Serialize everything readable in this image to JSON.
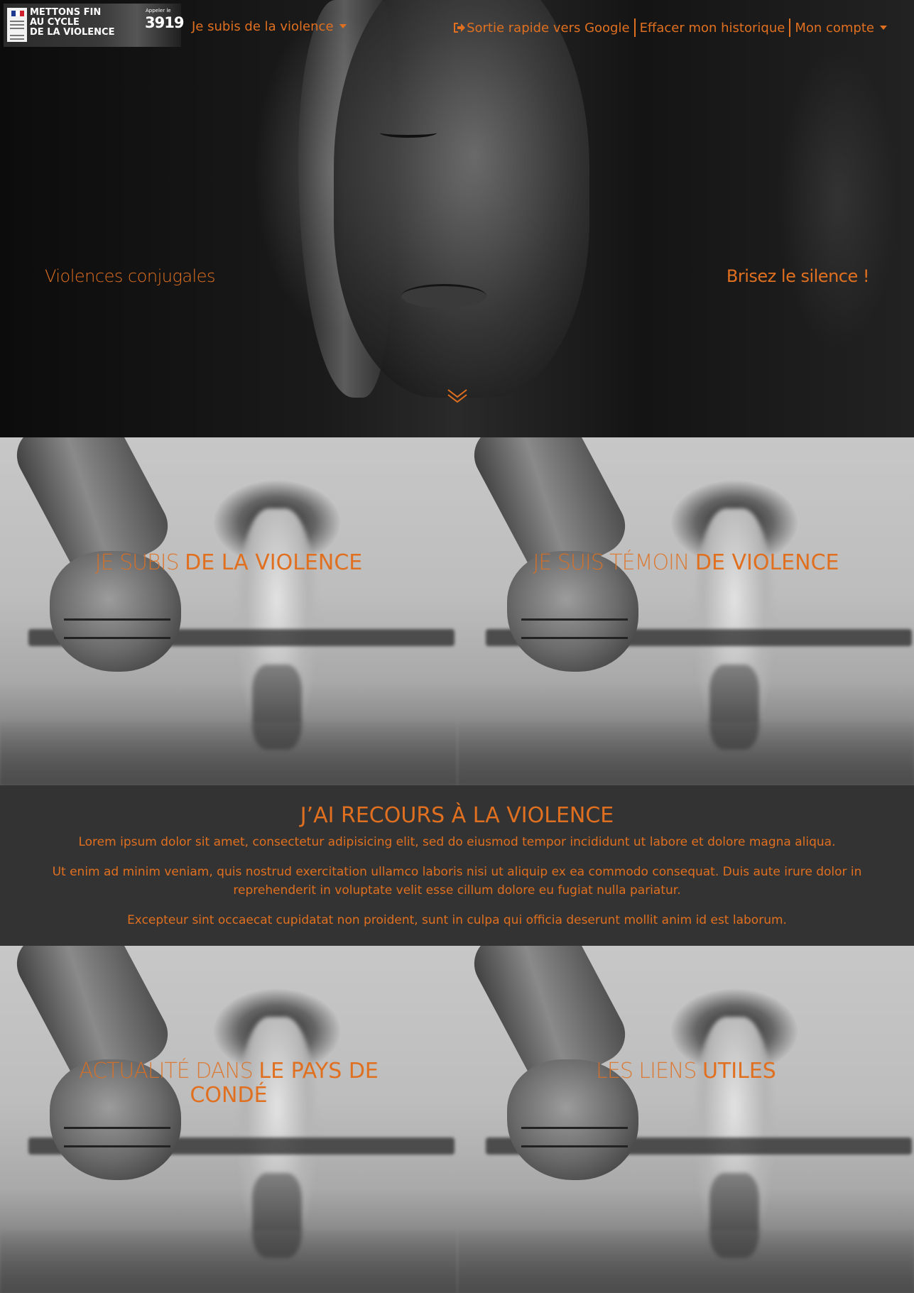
{
  "colors": {
    "accent": "#e07020",
    "dark_band": "#333333"
  },
  "logo": {
    "title": "METTONS FIN\nAU CYCLE\nDE LA VIOLENCE",
    "call_label": "Appeler le",
    "phone": "3919"
  },
  "nav": {
    "dropdown_label": "Je subis de la violence",
    "quick_exit": "Sortie rapide vers Google",
    "clear_history": "Effacer mon historique",
    "account": "Mon compte"
  },
  "hero": {
    "left_text": "Violences conjugales",
    "right_text": "Brisez le silence !",
    "scroll_icon": "chevron-down-icon"
  },
  "tiles": [
    {
      "light": "Je subis ",
      "bold": "de la violence"
    },
    {
      "light": "Je suis témoin ",
      "bold": "de violence"
    },
    {
      "light": "Actualité dans ",
      "bold": "le Pays de Condé"
    },
    {
      "light": "Les liens ",
      "bold": "utiles"
    }
  ],
  "band": {
    "title": "J’ai recours à la violence",
    "paragraphs": [
      "Lorem ipsum dolor sit amet, consectetur adipisicing elit, sed do eiusmod tempor incididunt ut labore et dolore magna aliqua.",
      "Ut enim ad minim veniam, quis nostrud exercitation ullamco laboris nisi ut aliquip ex ea commodo consequat. Duis aute irure dolor in reprehenderit in voluptate velit esse cillum dolore eu fugiat nulla pariatur.",
      "Excepteur sint occaecat cupidatat non proident, sunt in culpa qui officia deserunt mollit anim id est laborum."
    ]
  }
}
